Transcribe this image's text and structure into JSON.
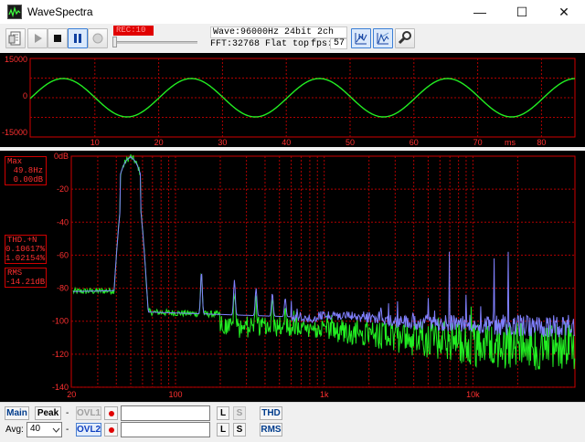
{
  "window": {
    "title": "WaveSpectra",
    "minimize_glyph": "—",
    "maximize_glyph": "☐",
    "close_glyph": "✕"
  },
  "toolbar": {
    "record_label": "REC:10",
    "record_level": 0.0,
    "wave_info": "Wave:96000Hz 24bit 2ch",
    "fft_info": "FFT:32768 Flat top",
    "fps_label": "fps:",
    "fps_value": "57",
    "buttons": [
      "file-open-icon",
      "play-icon",
      "stop-icon",
      "pause-icon",
      "record-icon",
      "range-h-icon",
      "setting-icon",
      "wrench-icon"
    ]
  },
  "wave_axis": {
    "y_ticks": [
      "15000",
      "0",
      "-15000"
    ],
    "x_ticks": [
      "10",
      "20",
      "30",
      "40",
      "50",
      "60",
      "70",
      "80"
    ],
    "x_unit": "ms"
  },
  "spectrum_axis": {
    "y_ticks": [
      "0dB",
      "-20",
      "-40",
      "-60",
      "-80",
      "-100",
      "-120",
      "-140"
    ],
    "x_ticks": [
      "20",
      "100",
      "1k",
      "10k"
    ]
  },
  "readouts": {
    "max_label": "Max",
    "max_freq": "49.8Hz",
    "max_level": "0.00dB",
    "thd_label": "THD.+N",
    "thd_value1": "0.10617%",
    "thd_value2": "1.02154%",
    "rms_label": "RMS",
    "rms_value": "-14.21dB"
  },
  "bottom": {
    "main_label": "Main",
    "peak_label": "Peak",
    "dash1": "-",
    "ovl1_label": "OVL1",
    "l_label": "L",
    "s_label": "S",
    "thd_label": "THD",
    "avg_label": "Avg:",
    "avg_value": "40",
    "dash2": "-",
    "ovl2_label": "OVL2",
    "rms_label": "RMS"
  },
  "colors": {
    "grid_red": "#b00000",
    "trace_green": "#22ee22",
    "trace_blue": "#8080ff",
    "frame_red": "#d00000",
    "text_red": "#ff3030"
  }
}
